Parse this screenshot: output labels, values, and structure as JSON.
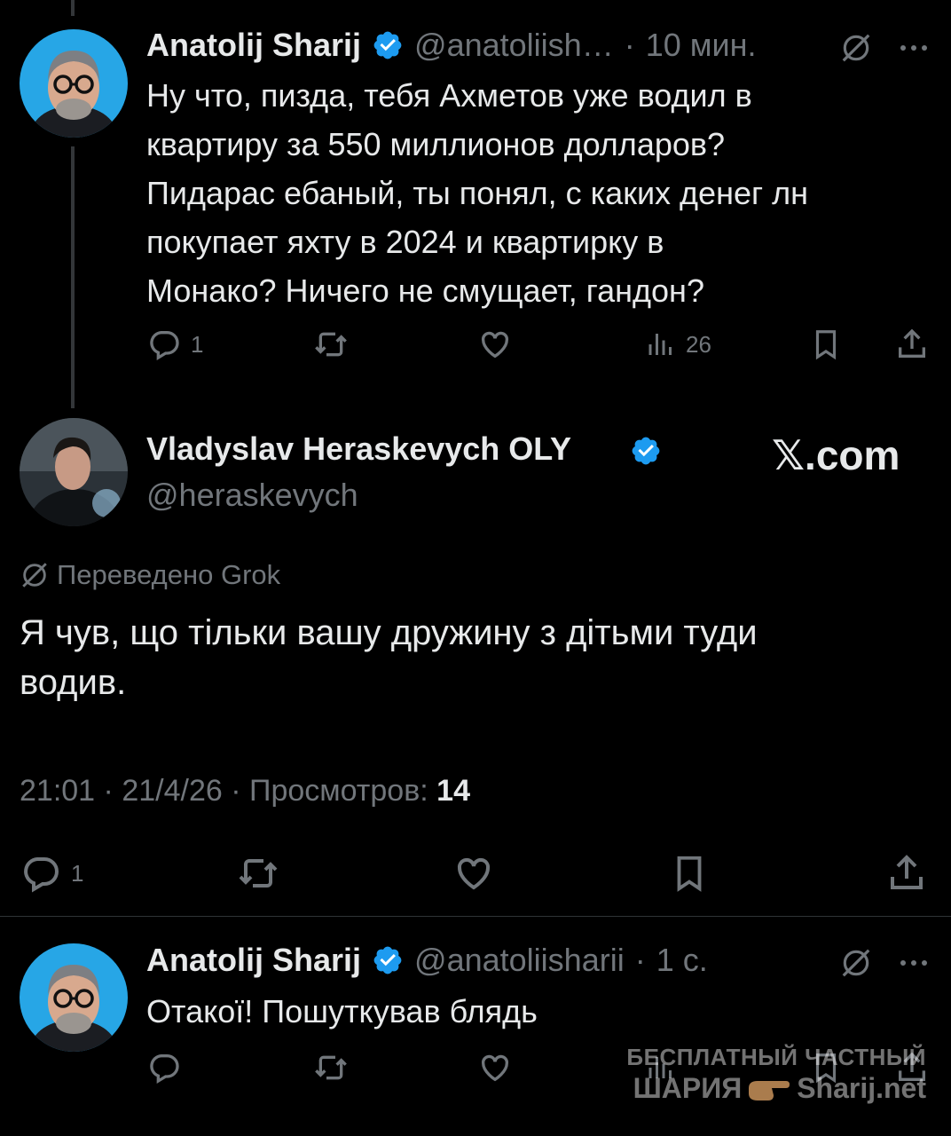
{
  "tweet1": {
    "author_name": "Anatolij Sharij",
    "handle": "@anatoliish…",
    "separator": "·",
    "time": "10 мин.",
    "text_lines": [
      "Ну что, пизда, тебя Ахметов уже водил в",
      "квартиру за 550 миллионов долларов?",
      "Пидарас ебаный, ты понял, с каких денег лн",
      "покупает яхту в 2024 и квартирку в",
      "Монако? Ничего не смущает, гандон?"
    ],
    "replies": "1",
    "views": "26",
    "icons": [
      "grok-icon",
      "more-icon",
      "reply-icon",
      "retweet-icon",
      "like-icon",
      "views-icon",
      "bookmark-icon",
      "share-icon"
    ]
  },
  "main_tweet": {
    "author_name": "Vladyslav Heraskevych OLY",
    "handle": "@heraskevych",
    "site_badge": "𝕏.com",
    "translated_label": "Переведено Grok",
    "text_lines": [
      "Я чув, що тільки вашу дружину з дітьми туди",
      "водив."
    ],
    "time": "21:01",
    "date": "21/4/26",
    "views_label": "Просмотров:",
    "views": "14",
    "separator": "·",
    "replies": "1"
  },
  "tweet3": {
    "author_name": "Anatolij Sharij",
    "handle": "@anatoliisharii",
    "separator": "·",
    "time": "1 с.",
    "text": "Отакої! Пошуткував блядь"
  },
  "watermark": {
    "line1": "БЕСПЛАТНЫЙ ЧАСТНЫЙ",
    "line2_left": "ШАРИЯ",
    "line2_right": "Sharij.net"
  },
  "colors": {
    "background": "#000000",
    "text": "#e7e9ea",
    "muted": "#71767b",
    "verified": "#1d9bf0",
    "divider": "#2f3336"
  }
}
